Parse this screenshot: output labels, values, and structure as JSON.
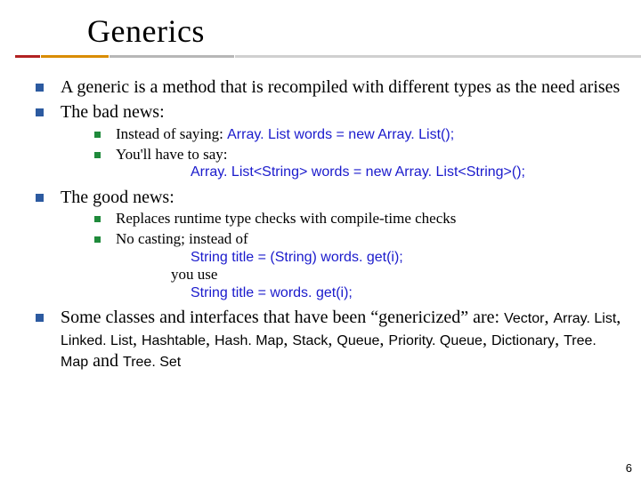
{
  "title": "Generics",
  "bullets": {
    "b1": "A generic is a method that is recompiled with different types as the need arises",
    "b2": "The bad news:",
    "b2a_pre": "Instead of saying: ",
    "b2a_code": "Array. List words = new Array. List();",
    "b2b": "You'll have to say:",
    "b2b_code": "Array. List<String> words = new Array. List<String>();",
    "b3": "The good news:",
    "b3a": "Replaces runtime type checks with compile-time checks",
    "b3b": "No casting; instead of",
    "b3b_code1": "String title = (String) words. get(i);",
    "b3b_mid": "you use",
    "b3b_code2": "String title = words. get(i);",
    "b4_pre": "Some classes and interfaces that have been “genericized” are: ",
    "b4_list_1": "Vector",
    "b4_c1": ", ",
    "b4_list_2": "Array. List",
    "b4_c2": ", ",
    "b4_list_3": "Linked. List",
    "b4_c3": ", ",
    "b4_list_4": "Hashtable",
    "b4_c4": ", ",
    "b4_list_5": "Hash. Map",
    "b4_c5": ", ",
    "b4_list_6": "Stack",
    "b4_c6": ", ",
    "b4_list_7": "Queue",
    "b4_c7": ", ",
    "b4_list_8": "Priority. Queue",
    "b4_c8": ", ",
    "b4_list_9": "Dictionary",
    "b4_c9": ", ",
    "b4_list_10": "Tree. Map",
    "b4_and": " and ",
    "b4_list_11": "Tree. Set"
  },
  "page": "6"
}
